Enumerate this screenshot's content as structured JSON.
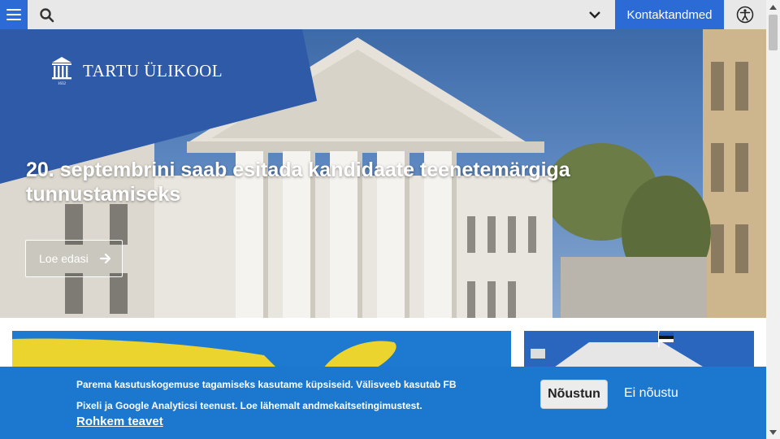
{
  "topbar": {
    "search_placeholder": "",
    "contact_label": "Kontaktandmed"
  },
  "hero": {
    "logo_text": "TARTU ÜLIKOOL",
    "logo_year": "1632",
    "headline": "20. septembrini saab esitada kandidaate teenetemärgiga tunnustamiseks",
    "read_more_label": "Loe edasi"
  },
  "cookie_banner": {
    "text": "Parema kasutuskogemuse tagamiseks kasutame küpsiseid. Välisveeb kasutab FB Pixeli ja Google Analyticsi teenust. Loe lähemalt andmekaitsetingimustest.",
    "more_link": "Rohkem teavet",
    "agree_label": "Nõustun",
    "disagree_label": "Ei nõustu"
  },
  "icons": [
    "menu-icon",
    "search-icon",
    "chevron-down-icon",
    "accessibility-icon",
    "arrow-right-icon",
    "university-logo-icon"
  ],
  "colors": {
    "accent": "#2c6bd6",
    "logo_panel": "#2f5aa8",
    "cookie_banner": "#1c78cf",
    "topbar": "#e8e8e8"
  }
}
